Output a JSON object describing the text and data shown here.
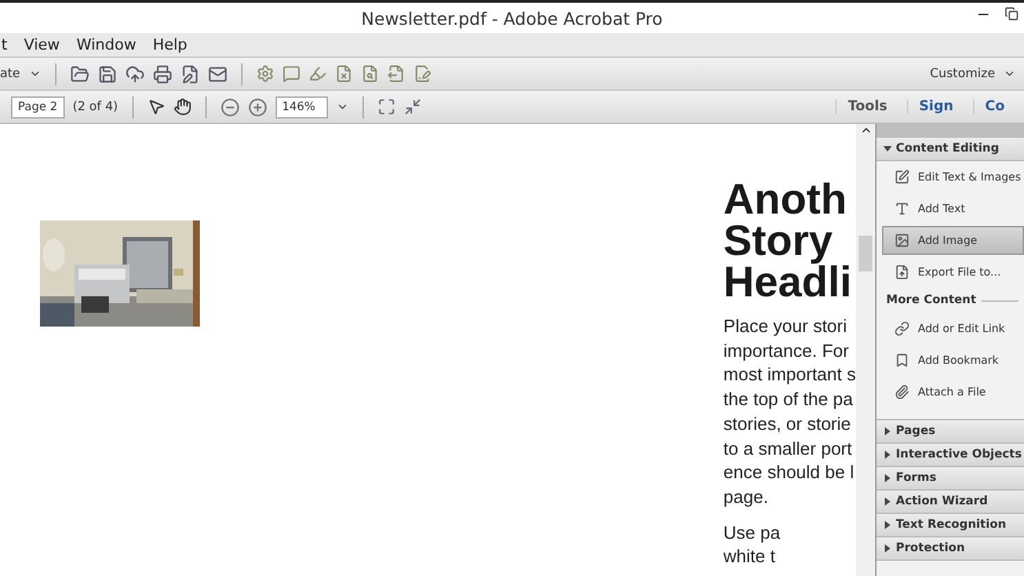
{
  "window": {
    "title": "Newsletter.pdf - Adobe Acrobat Pro"
  },
  "menu": [
    "t",
    "View",
    "Window",
    "Help"
  ],
  "toolbar": {
    "create_label": "ate",
    "customize_label": "Customize"
  },
  "nav": {
    "page_field": "Page 2",
    "page_count": "(2 of 4)",
    "zoom": "146%"
  },
  "panes": [
    {
      "label": "Tools",
      "selected": false
    },
    {
      "label": "Sign",
      "selected": false
    },
    {
      "label": "Co",
      "selected": false
    }
  ],
  "document": {
    "heading": [
      "Anoth",
      "Story",
      "Headli"
    ],
    "lines": [
      "Place your stori",
      "importance. For",
      "most important s",
      "the top of the pa",
      "stories, or storie",
      "to a smaller port",
      "ence should be l",
      "page."
    ],
    "lines_2": [
      "Use pa",
      "white t"
    ],
    "image": {
      "kind": "picture"
    }
  },
  "panel": {
    "section": {
      "label": "Content Editing",
      "expanded": true
    },
    "items": [
      {
        "label": "Edit Text & Images",
        "selected": false
      },
      {
        "label": "Add Text",
        "selected": false
      },
      {
        "label": "Add Image",
        "selected": true
      },
      {
        "label": "Export File to...",
        "selected": false
      }
    ],
    "subheading": "More Content",
    "more_items": [
      {
        "label": "Add or Edit Link",
        "selected": false
      },
      {
        "label": "Add Bookmark",
        "selected": false
      },
      {
        "label": "Attach a File",
        "selected": false
      }
    ],
    "collapsed_sections": [
      {
        "label": "Pages",
        "expanded": false
      },
      {
        "label": "Interactive Objects",
        "expanded": false
      },
      {
        "label": "Forms",
        "expanded": false
      },
      {
        "label": "Action Wizard",
        "expanded": false
      },
      {
        "label": "Text Recognition",
        "expanded": false
      },
      {
        "label": "Protection",
        "expanded": false
      }
    ]
  }
}
